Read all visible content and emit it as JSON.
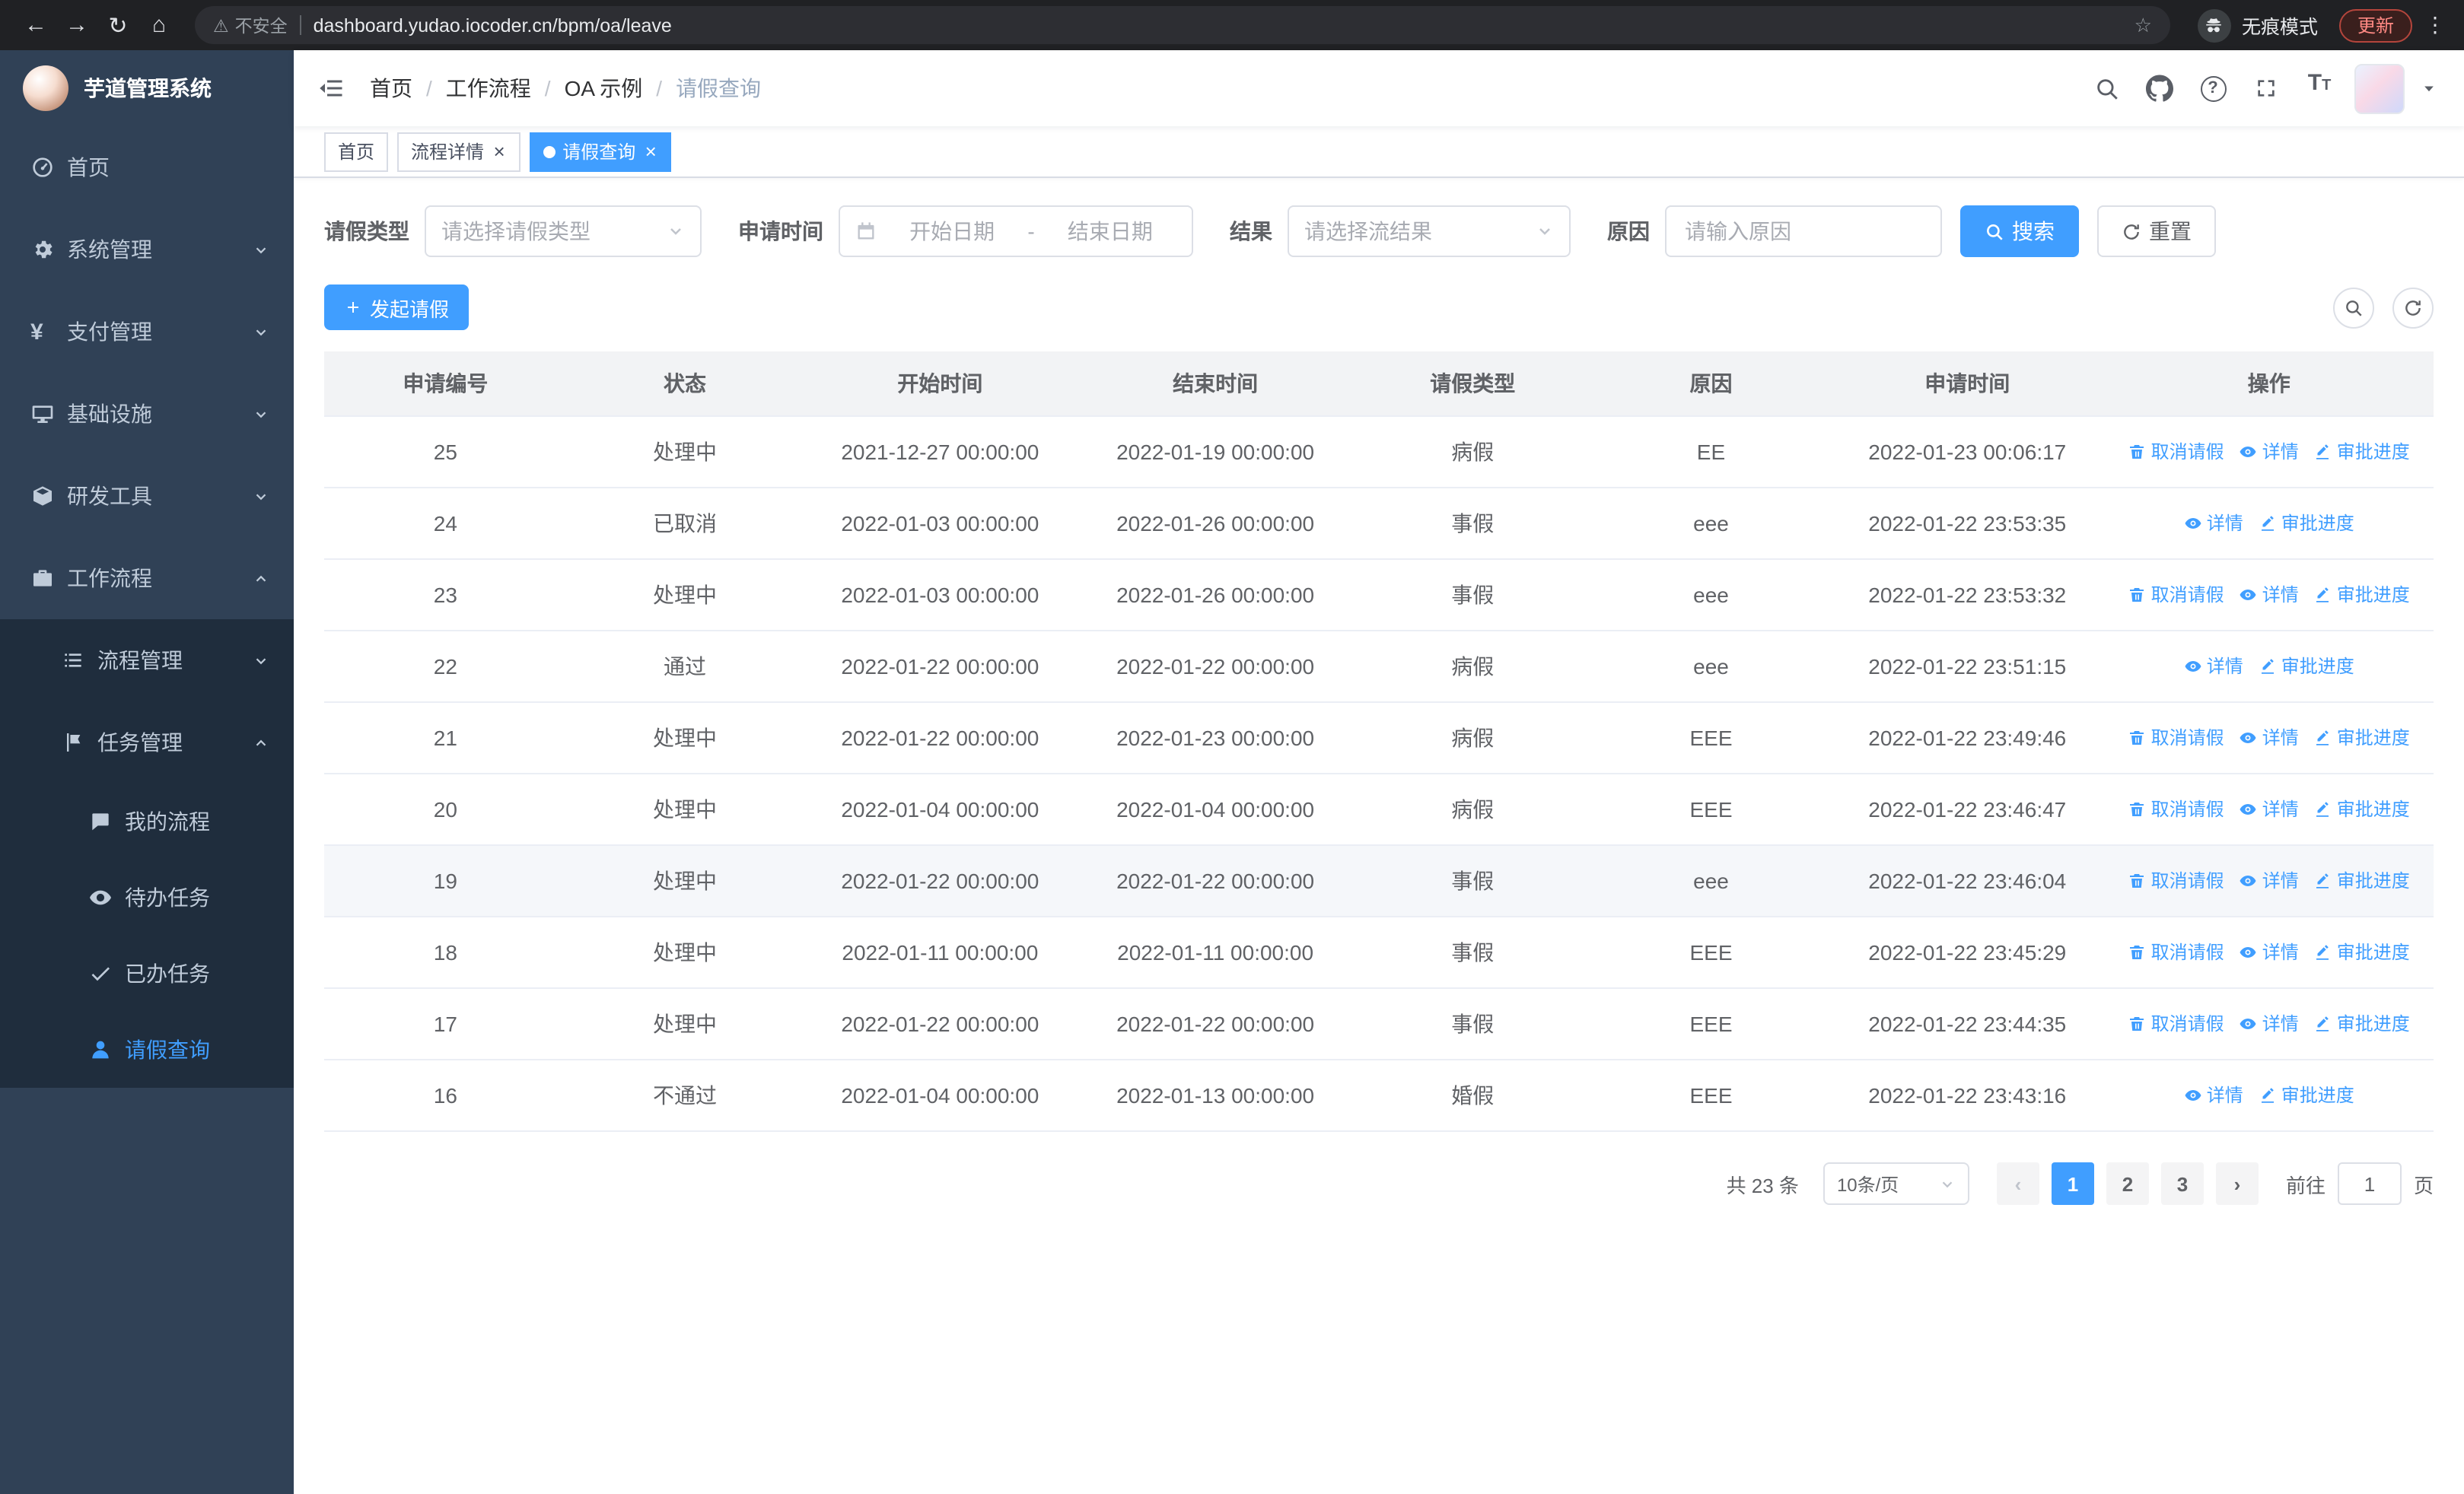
{
  "browser": {
    "back_icon": "←",
    "forward_icon": "→",
    "reload_icon": "↻",
    "home_icon": "⌂",
    "warning_icon": "⚠",
    "security_warning": "不安全",
    "url": "dashboard.yudao.iocoder.cn/bpm/oa/leave",
    "star_icon": "☆",
    "incognito_label": "无痕模式",
    "update_button": "更新",
    "menu_icon": "⋮"
  },
  "sidebar": {
    "app_title": "芋道管理系统",
    "menu": [
      {
        "label": "首页"
      },
      {
        "label": "系统管理"
      },
      {
        "label": "支付管理"
      },
      {
        "label": "基础设施"
      },
      {
        "label": "研发工具"
      },
      {
        "label": "工作流程"
      },
      {
        "label": "流程管理"
      },
      {
        "label": "任务管理"
      },
      {
        "label": "我的流程"
      },
      {
        "label": "待办任务"
      },
      {
        "label": "已办任务"
      },
      {
        "label": "请假查询"
      }
    ]
  },
  "header": {
    "breadcrumb": [
      "首页",
      "工作流程",
      "OA 示例",
      "请假查询"
    ]
  },
  "tabs": [
    {
      "label": "首页",
      "closable": false,
      "active": false
    },
    {
      "label": "流程详情",
      "closable": true,
      "active": false
    },
    {
      "label": "请假查询",
      "closable": true,
      "active": true
    }
  ],
  "filters": {
    "leave_type_label": "请假类型",
    "leave_type_placeholder": "请选择请假类型",
    "apply_time_label": "申请时间",
    "start_date_placeholder": "开始日期",
    "range_separator": "-",
    "end_date_placeholder": "结束日期",
    "result_label": "结果",
    "result_placeholder": "请选择流结果",
    "reason_label": "原因",
    "reason_placeholder": "请输入原因",
    "search_button": "搜索",
    "reset_button": "重置"
  },
  "toolbar": {
    "create_button": "发起请假"
  },
  "table": {
    "columns": [
      "申请编号",
      "状态",
      "开始时间",
      "结束时间",
      "请假类型",
      "原因",
      "申请时间",
      "操作"
    ],
    "actions": {
      "cancel": "取消请假",
      "detail": "详情",
      "progress": "审批进度"
    },
    "rows": [
      {
        "id": "25",
        "status": "处理中",
        "start": "2021-12-27 00:00:00",
        "end": "2022-01-19 00:00:00",
        "type": "病假",
        "reason": "EE",
        "apply_time": "2022-01-23 00:06:17",
        "can_cancel": true,
        "hover": false
      },
      {
        "id": "24",
        "status": "已取消",
        "start": "2022-01-03 00:00:00",
        "end": "2022-01-26 00:00:00",
        "type": "事假",
        "reason": "eee",
        "apply_time": "2022-01-22 23:53:35",
        "can_cancel": false,
        "hover": false
      },
      {
        "id": "23",
        "status": "处理中",
        "start": "2022-01-03 00:00:00",
        "end": "2022-01-26 00:00:00",
        "type": "事假",
        "reason": "eee",
        "apply_time": "2022-01-22 23:53:32",
        "can_cancel": true,
        "hover": false
      },
      {
        "id": "22",
        "status": "通过",
        "start": "2022-01-22 00:00:00",
        "end": "2022-01-22 00:00:00",
        "type": "病假",
        "reason": "eee",
        "apply_time": "2022-01-22 23:51:15",
        "can_cancel": false,
        "hover": false
      },
      {
        "id": "21",
        "status": "处理中",
        "start": "2022-01-22 00:00:00",
        "end": "2022-01-23 00:00:00",
        "type": "病假",
        "reason": "EEE",
        "apply_time": "2022-01-22 23:49:46",
        "can_cancel": true,
        "hover": false
      },
      {
        "id": "20",
        "status": "处理中",
        "start": "2022-01-04 00:00:00",
        "end": "2022-01-04 00:00:00",
        "type": "病假",
        "reason": "EEE",
        "apply_time": "2022-01-22 23:46:47",
        "can_cancel": true,
        "hover": false
      },
      {
        "id": "19",
        "status": "处理中",
        "start": "2022-01-22 00:00:00",
        "end": "2022-01-22 00:00:00",
        "type": "事假",
        "reason": "eee",
        "apply_time": "2022-01-22 23:46:04",
        "can_cancel": true,
        "hover": true
      },
      {
        "id": "18",
        "status": "处理中",
        "start": "2022-01-11 00:00:00",
        "end": "2022-01-11 00:00:00",
        "type": "事假",
        "reason": "EEE",
        "apply_time": "2022-01-22 23:45:29",
        "can_cancel": true,
        "hover": false
      },
      {
        "id": "17",
        "status": "处理中",
        "start": "2022-01-22 00:00:00",
        "end": "2022-01-22 00:00:00",
        "type": "事假",
        "reason": "EEE",
        "apply_time": "2022-01-22 23:44:35",
        "can_cancel": true,
        "hover": false
      },
      {
        "id": "16",
        "status": "不通过",
        "start": "2022-01-04 00:00:00",
        "end": "2022-01-13 00:00:00",
        "type": "婚假",
        "reason": "EEE",
        "apply_time": "2022-01-22 23:43:16",
        "can_cancel": false,
        "hover": false
      }
    ]
  },
  "pagination": {
    "total_text": "共 23 条",
    "page_size": "10条/页",
    "prev_icon": "‹",
    "next_icon": "›",
    "pages": [
      "1",
      "2",
      "3"
    ],
    "active_page": "1",
    "goto_label": "前往",
    "goto_value": "1",
    "goto_suffix": "页"
  },
  "colors": {
    "primary": "#409eff",
    "sidebar_bg": "#304156",
    "sidebar_submenu_bg": "#1f2d3d",
    "sidebar_text": "#bfcbd9",
    "table_border": "#ebeef5",
    "hover_row_bg": "#f5f7fa"
  }
}
